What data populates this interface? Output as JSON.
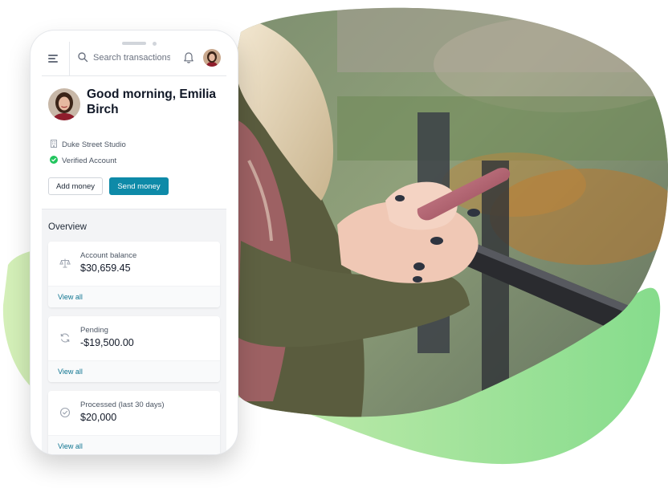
{
  "header": {
    "search_placeholder": "Search transactions"
  },
  "profile": {
    "greeting": "Good morning, Emilia Birch",
    "company": "Duke Street Studio",
    "verification": "Verified Account"
  },
  "actions": {
    "add_money": "Add money",
    "send_money": "Send money"
  },
  "overview": {
    "title": "Overview",
    "cards": [
      {
        "label": "Account balance",
        "value": "$30,659.45",
        "link": "View all",
        "icon": "scale-icon"
      },
      {
        "label": "Pending",
        "value": "-$19,500.00",
        "link": "View all",
        "icon": "refresh-icon"
      },
      {
        "label": "Processed (last 30 days)",
        "value": "$20,000",
        "link": "View all",
        "icon": "check-circle-icon"
      }
    ]
  },
  "colors": {
    "accent": "#0e8aa8",
    "link": "#0e7490",
    "verified": "#22c55e",
    "blob_green": "#a3e4a8"
  }
}
